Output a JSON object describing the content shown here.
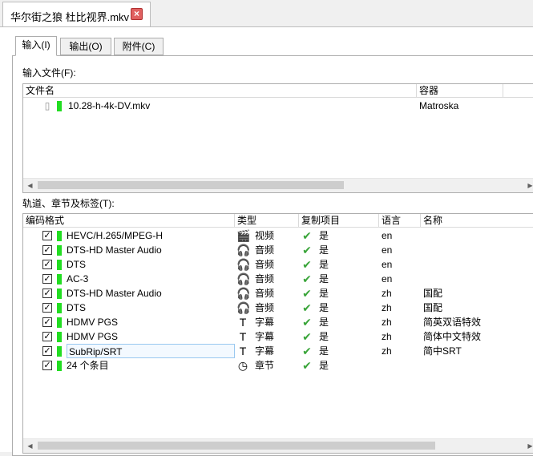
{
  "document_tab": {
    "title": "华尔街之狼 杜比视界.mkv",
    "close_icon": "close-icon",
    "close_color": "#e06060"
  },
  "subtabs": [
    {
      "label": "输入(I)",
      "active": true
    },
    {
      "label": "输出(O)",
      "active": false
    },
    {
      "label": "附件(C)",
      "active": false
    }
  ],
  "input_files": {
    "label": "输入文件(F):",
    "columns": {
      "filename": "文件名",
      "container": "容器"
    },
    "files": [
      {
        "name": "10.28-h-4k-DV.mkv",
        "container": "Matroska"
      }
    ]
  },
  "tracks": {
    "label": "轨道、章节及标签(T):",
    "columns": {
      "codec": "编码格式",
      "type": "类型",
      "copy": "复制项目",
      "language": "语言",
      "name": "名称"
    },
    "rows": [
      {
        "checked": true,
        "codec": "HEVC/H.265/MPEG-H",
        "type_icon": "video-icon",
        "type": "视频",
        "copy": "是",
        "language": "en",
        "name": ""
      },
      {
        "checked": true,
        "codec": "DTS-HD Master Audio",
        "type_icon": "headphones-icon",
        "type": "音频",
        "copy": "是",
        "language": "en",
        "name": ""
      },
      {
        "checked": true,
        "codec": "DTS",
        "type_icon": "headphones-icon",
        "type": "音频",
        "copy": "是",
        "language": "en",
        "name": ""
      },
      {
        "checked": true,
        "codec": "AC-3",
        "type_icon": "headphones-icon",
        "type": "音频",
        "copy": "是",
        "language": "en",
        "name": ""
      },
      {
        "checked": true,
        "codec": "DTS-HD Master Audio",
        "type_icon": "headphones-icon",
        "type": "音频",
        "copy": "是",
        "language": "zh",
        "name": "国配"
      },
      {
        "checked": true,
        "codec": "DTS",
        "type_icon": "headphones-icon",
        "type": "音频",
        "copy": "是",
        "language": "zh",
        "name": "国配"
      },
      {
        "checked": true,
        "codec": "HDMV PGS",
        "type_icon": "text-icon",
        "type": "字幕",
        "copy": "是",
        "language": "zh",
        "name": "简英双语特效"
      },
      {
        "checked": true,
        "codec": "HDMV PGS",
        "type_icon": "text-icon",
        "type": "字幕",
        "copy": "是",
        "language": "zh",
        "name": "简体中文特效"
      },
      {
        "checked": true,
        "codec": "SubRip/SRT",
        "type_icon": "text-icon",
        "type": "字幕",
        "copy": "是",
        "language": "zh",
        "name": "简中SRT",
        "selected": true
      },
      {
        "checked": true,
        "codec": "24 个条目",
        "type_icon": "clock-icon",
        "type": "章节",
        "copy": "是",
        "language": "",
        "name": ""
      }
    ]
  },
  "colors": {
    "marker_green": "#22dd22",
    "copy_check_green": "#3aa53a"
  }
}
